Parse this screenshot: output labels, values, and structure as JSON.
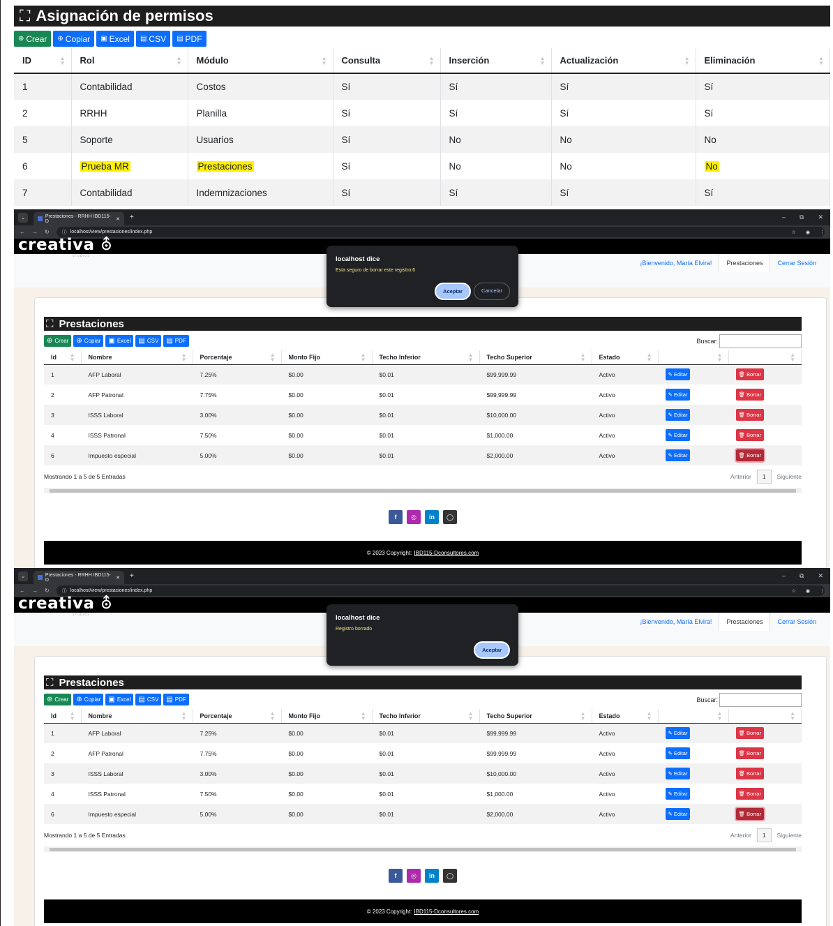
{
  "permisos": {
    "title": "Asignación de permisos",
    "buttons": [
      "Crear",
      "Copiar",
      "Excel",
      "CSV",
      "PDF"
    ],
    "columns": [
      "ID",
      "Rol",
      "Módulo",
      "Consulta",
      "Inserción",
      "Actualización",
      "Eliminación"
    ],
    "rows": [
      [
        "1",
        "Contabilidad",
        "Costos",
        "Sí",
        "Sí",
        "Sí",
        "Sí"
      ],
      [
        "2",
        "RRHH",
        "Planilla",
        "Sí",
        "Sí",
        "Sí",
        "Sí"
      ],
      [
        "5",
        "Soporte",
        "Usuarios",
        "Sí",
        "No",
        "No",
        "No"
      ],
      [
        "6",
        "Prueba MR",
        "Prestaciones",
        "Sí",
        "No",
        "No",
        "No"
      ],
      [
        "7",
        "Contabilidad",
        "Indemnizaciones",
        "Sí",
        "Sí",
        "Sí",
        "Sí"
      ]
    ],
    "highlight_color": "#fff100"
  },
  "browser": {
    "tab_title": "Prestaciones - RRHH IBD115-D",
    "url": "localhost/view/prestaciones/index.php"
  },
  "site": {
    "logo": "creativa",
    "logo_sub": "STUDIOS",
    "nav": [
      "¡Bienvenido, María Elvira!",
      "Prestaciones",
      "Cerrar Sesión"
    ]
  },
  "prestaciones": {
    "title": "Prestaciones",
    "buttons": [
      "Crear",
      "Copiar",
      "Excel",
      "CSV",
      "PDF"
    ],
    "search_label": "Buscar:",
    "columns": [
      "Id",
      "Nombre",
      "Porcentaje",
      "Monto Fijo",
      "Techo Inferior",
      "Techo Superior",
      "Estado",
      "",
      ""
    ],
    "rows": [
      [
        "1",
        "AFP Laboral",
        "7.25%",
        "$0.00",
        "$0.01",
        "$99,999.99",
        "Activo"
      ],
      [
        "2",
        "AFP Patronal",
        "7.75%",
        "$0.00",
        "$0.01",
        "$99,999.99",
        "Activo"
      ],
      [
        "3",
        "ISSS Laboral",
        "3.00%",
        "$0.00",
        "$0.01",
        "$10,000.00",
        "Activo"
      ],
      [
        "4",
        "ISSS Patronal",
        "7.50%",
        "$0.00",
        "$0.01",
        "$1,000.00",
        "Activo"
      ],
      [
        "6",
        "Impuesto especial",
        "5.00%",
        "$0.00",
        "$0.01",
        "$2,000.00",
        "Activo"
      ]
    ],
    "edit_label": "Editar",
    "delete_label": "Borrar",
    "info": "Mostrando 1 a 5 de 5 Entradas",
    "prev": "Anterior",
    "page": "1",
    "next": "Siguiente",
    "footer_text": "© 2023 Copyright:",
    "footer_link": "IBD115-Dconsultores.com"
  },
  "dialogs": {
    "confirm": {
      "title": "localhost dice",
      "message": "Esta seguro de borrar este registro:6",
      "ok": "Aceptar",
      "cancel": "Cancelar"
    },
    "alert": {
      "title": "localhost dice",
      "message": "Registro borrado",
      "ok": "Aceptar"
    }
  },
  "colors": {
    "green": "#198754",
    "blue": "#0d6efd",
    "red": "#dc3545",
    "dark": "#1e1e1e"
  }
}
